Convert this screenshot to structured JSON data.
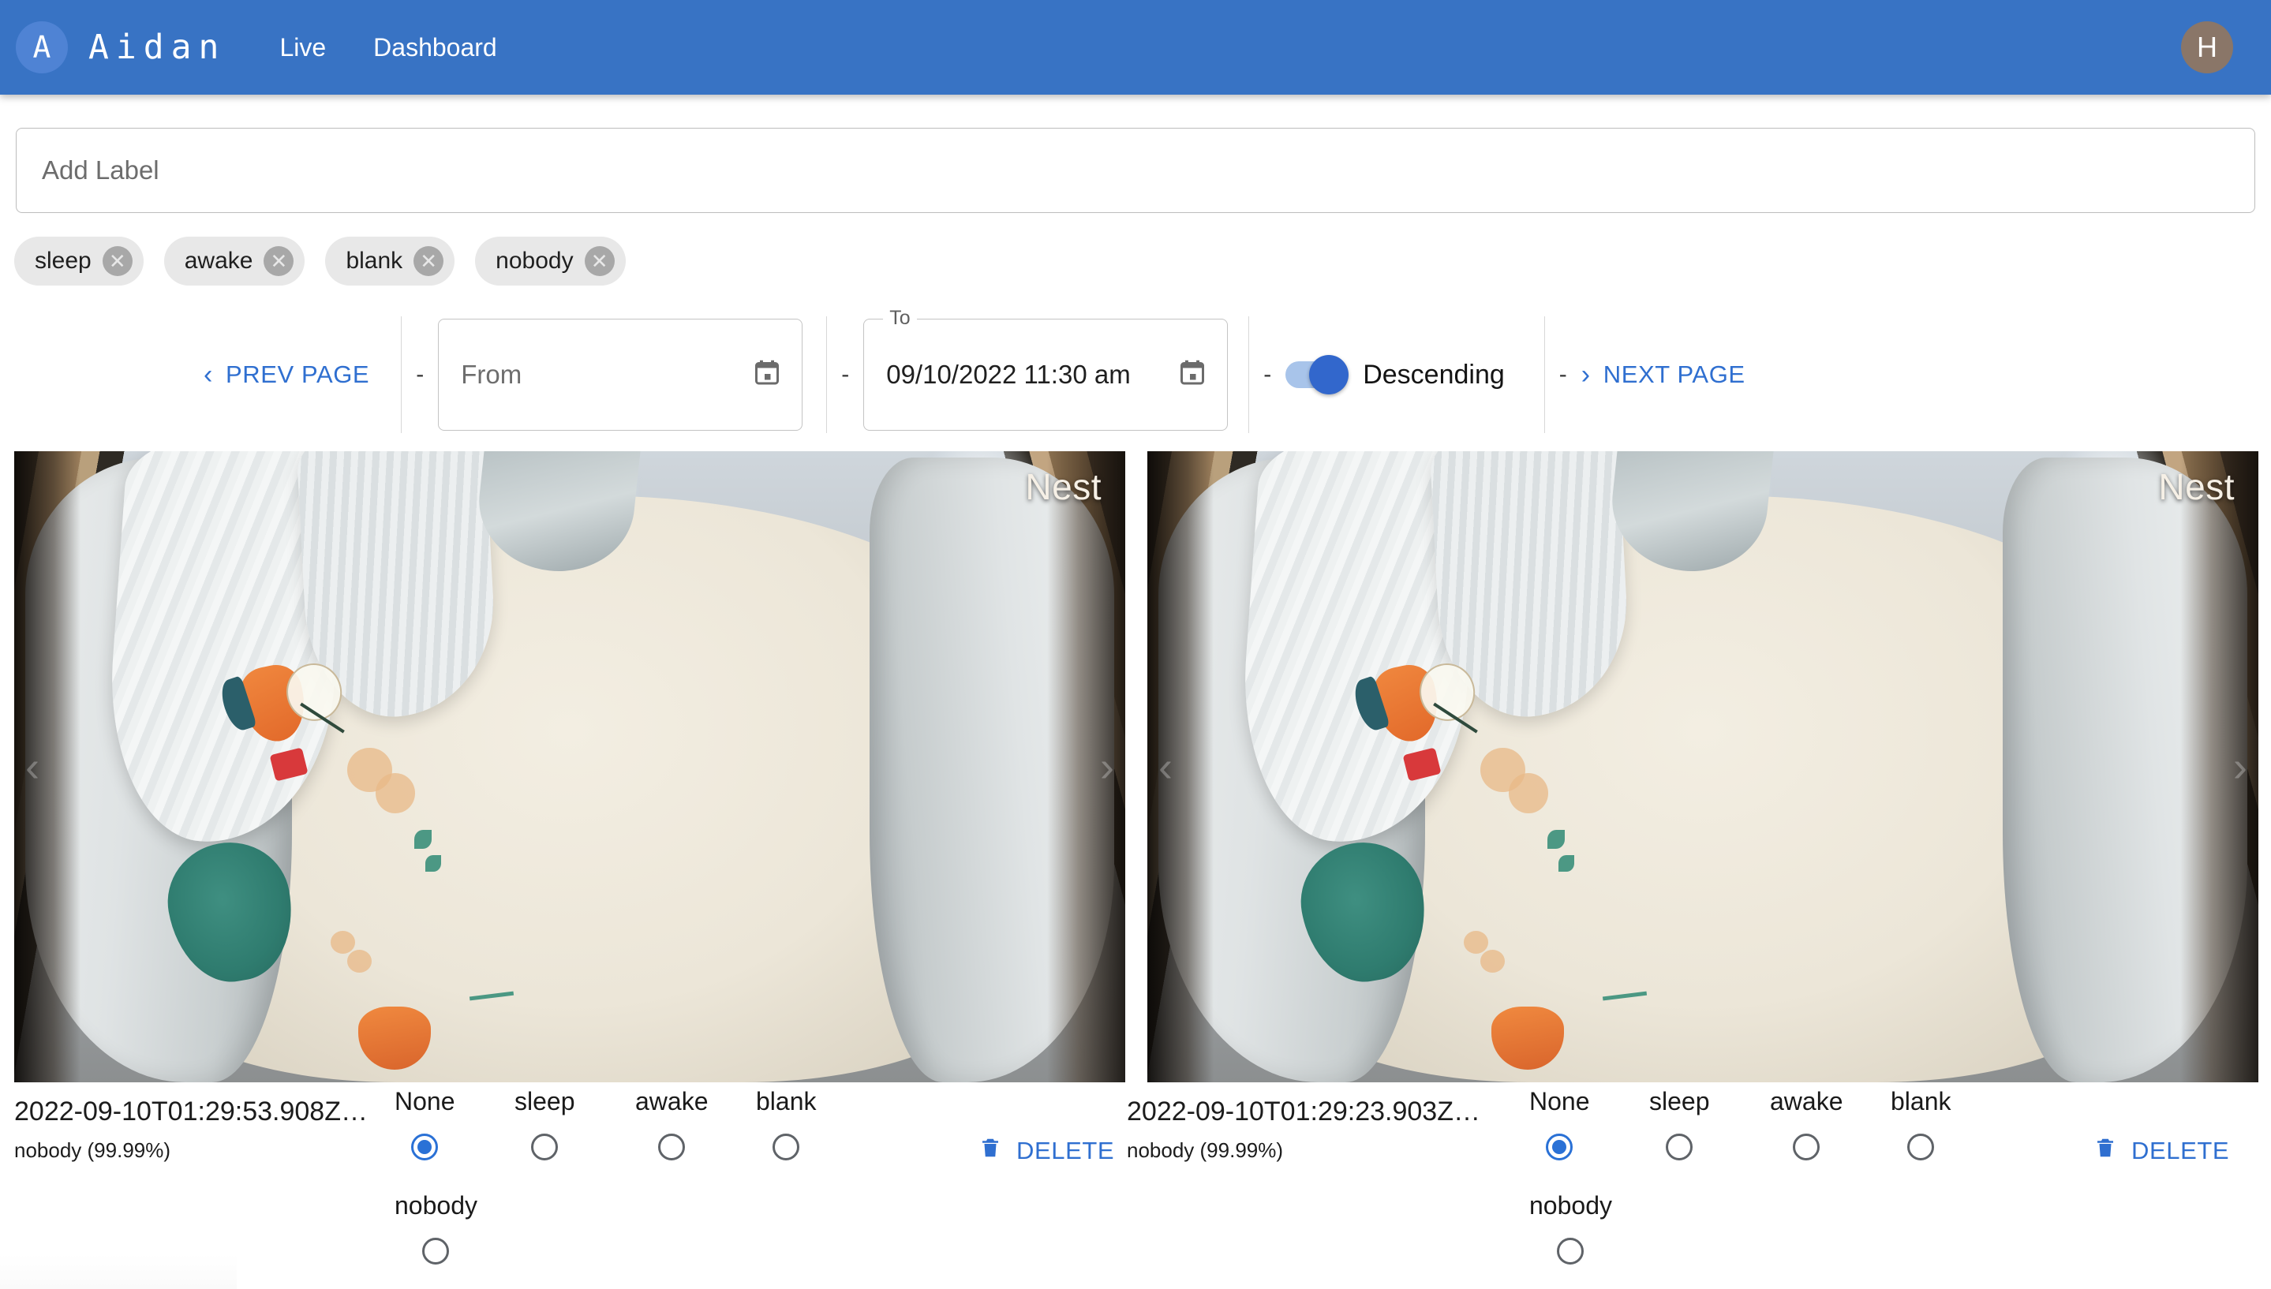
{
  "appbar": {
    "brand_initial": "A",
    "brand_name": "Aidan",
    "nav": [
      {
        "label": "Live"
      },
      {
        "label": "Dashboard"
      }
    ],
    "user_initial": "H",
    "colors": {
      "bar": "#3873c4",
      "brand_avatar": "#4f83d4",
      "user_avatar": "#8a7668"
    }
  },
  "label_input": {
    "placeholder": "Add Label",
    "value": ""
  },
  "chips": [
    {
      "label": "sleep",
      "remove": "✕"
    },
    {
      "label": "awake",
      "remove": "✕"
    },
    {
      "label": "blank",
      "remove": "✕"
    },
    {
      "label": "nobody",
      "remove": "✕"
    }
  ],
  "toolbar": {
    "prev_page": "PREV PAGE",
    "next_page": "NEXT PAGE",
    "prev_chevron": "‹",
    "next_chevron": "›",
    "separator": "-",
    "from": {
      "legend": "",
      "placeholder": "From",
      "value": ""
    },
    "to": {
      "legend": "To",
      "placeholder": "",
      "value": "09/10/2022 11:30 am"
    },
    "sort_toggle": {
      "label": "Descending",
      "on": true
    },
    "calendar_icon": "calendar-icon"
  },
  "cards": [
    {
      "watermark": "Nest",
      "timestamp": "2022-09-10T01:29:53.908Z…",
      "prediction": "nobody (99.99%)",
      "radios_row1": [
        {
          "label": "None",
          "checked": true
        },
        {
          "label": "sleep",
          "checked": false
        },
        {
          "label": "awake",
          "checked": false
        },
        {
          "label": "blank",
          "checked": false
        }
      ],
      "radios_row2": [
        {
          "label": "nobody",
          "checked": false
        }
      ],
      "delete_label": "DELETE"
    },
    {
      "watermark": "Nest",
      "timestamp": "2022-09-10T01:29:23.903Z…",
      "prediction": "nobody (99.99%)",
      "radios_row1": [
        {
          "label": "None",
          "checked": true
        },
        {
          "label": "sleep",
          "checked": false
        },
        {
          "label": "awake",
          "checked": false
        },
        {
          "label": "blank",
          "checked": false
        }
      ],
      "radios_row2": [
        {
          "label": "nobody",
          "checked": false
        }
      ],
      "delete_label": "DELETE"
    }
  ],
  "photo_nav": {
    "left": "‹",
    "right": "›"
  },
  "colors": {
    "link_blue": "#2f6fd0",
    "radio_blue": "#2a71d6",
    "toggle_track": "#a8c4ea",
    "toggle_knob": "#3267cc",
    "chip_bg": "#e8e8e8"
  }
}
